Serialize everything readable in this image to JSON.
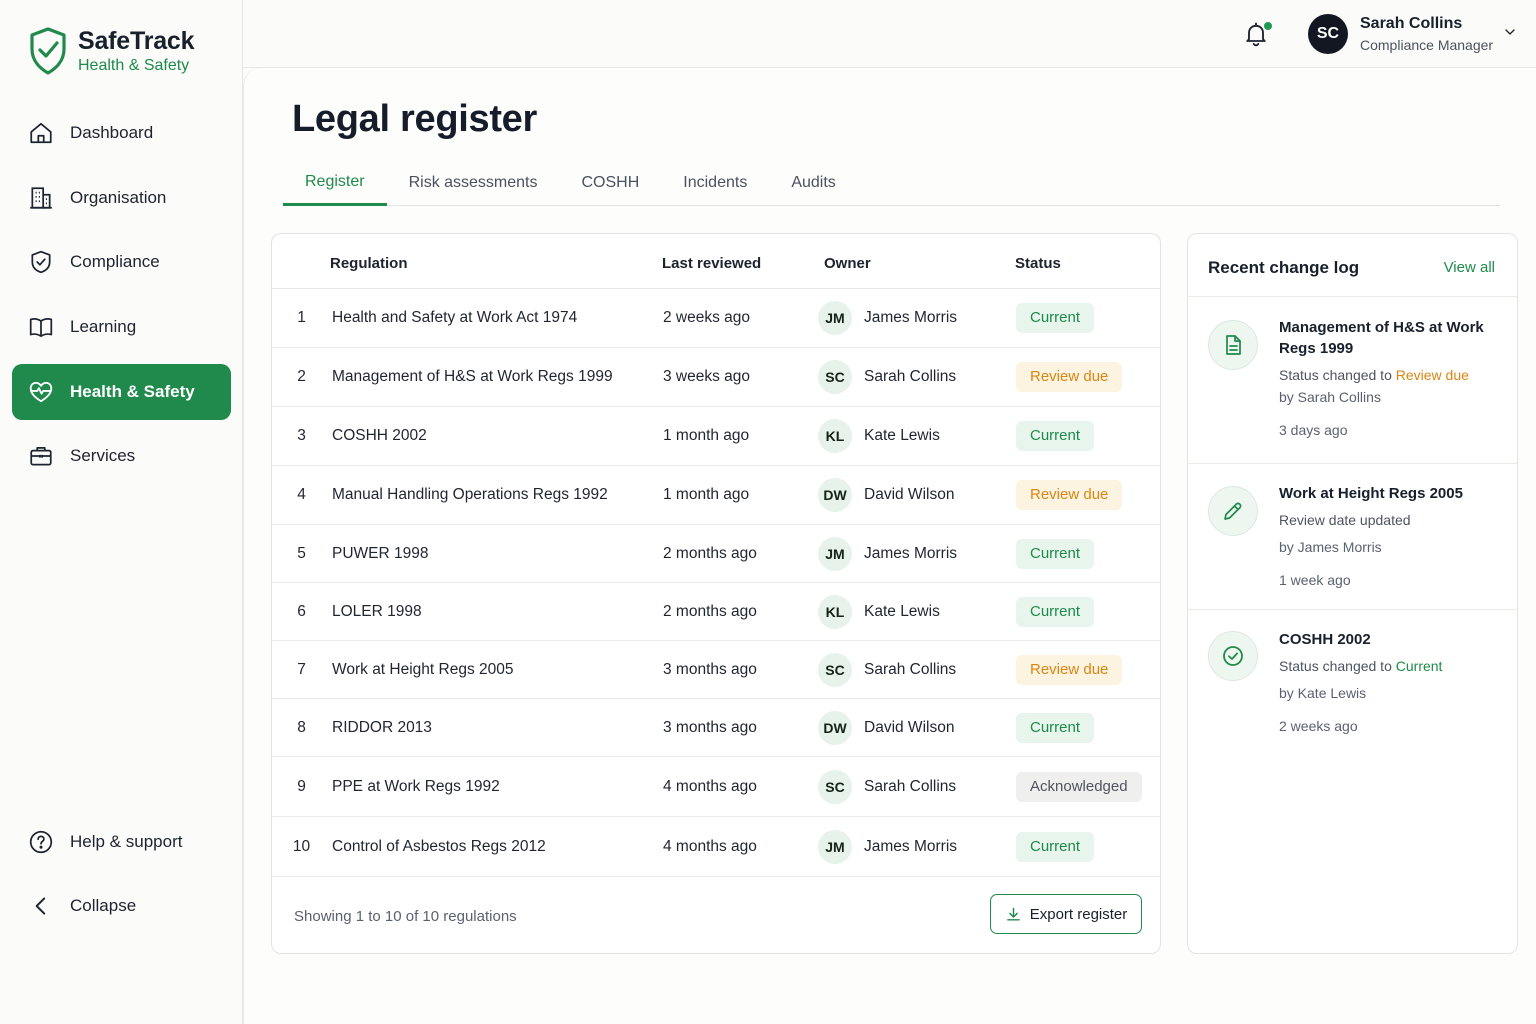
{
  "brand": {
    "name": "SafeTrack",
    "subtitle": "Health & Safety"
  },
  "nav": {
    "items": [
      {
        "label": "Dashboard",
        "icon": "home-icon"
      },
      {
        "label": "Organisation",
        "icon": "building-icon"
      },
      {
        "label": "Compliance",
        "icon": "shield-check-icon"
      },
      {
        "label": "Learning",
        "icon": "book-icon"
      },
      {
        "label": "Health & Safety",
        "icon": "heart-pulse-icon",
        "active": true
      },
      {
        "label": "Services",
        "icon": "briefcase-icon"
      }
    ],
    "bottom": [
      {
        "label": "Help & support",
        "icon": "help-icon"
      },
      {
        "label": "Collapse",
        "icon": "chevron-left-icon"
      }
    ]
  },
  "user": {
    "initials": "SC",
    "name": "Sarah Collins",
    "role": "Compliance Manager"
  },
  "page": {
    "title": "Legal register"
  },
  "tabs": [
    {
      "label": "Register",
      "active": true
    },
    {
      "label": "Risk assessments"
    },
    {
      "label": "COSHH"
    },
    {
      "label": "Incidents"
    },
    {
      "label": "Audits"
    }
  ],
  "table": {
    "headers": {
      "regulation": "Regulation",
      "last_reviewed": "Last reviewed",
      "owner": "Owner",
      "status": "Status"
    },
    "rows": [
      {
        "num": "1",
        "regulation": "Health and Safety at Work Act 1974",
        "reviewed": "2 weeks ago",
        "initials": "JM",
        "owner": "James Morris",
        "status": "Current",
        "kind": "current"
      },
      {
        "num": "2",
        "regulation": "Management of H&S at Work Regs 1999",
        "reviewed": "3 weeks ago",
        "initials": "SC",
        "owner": "Sarah Collins",
        "status": "Review due",
        "kind": "due"
      },
      {
        "num": "3",
        "regulation": "COSHH 2002",
        "reviewed": "1 month ago",
        "initials": "KL",
        "owner": "Kate Lewis",
        "status": "Current",
        "kind": "current"
      },
      {
        "num": "4",
        "regulation": "Manual Handling Operations Regs 1992",
        "reviewed": "1 month ago",
        "initials": "DW",
        "owner": "David Wilson",
        "status": "Review due",
        "kind": "due"
      },
      {
        "num": "5",
        "regulation": "PUWER 1998",
        "reviewed": "2 months ago",
        "initials": "JM",
        "owner": "James Morris",
        "status": "Current",
        "kind": "current"
      },
      {
        "num": "6",
        "regulation": "LOLER 1998",
        "reviewed": "2 months ago",
        "initials": "KL",
        "owner": "Kate Lewis",
        "status": "Current",
        "kind": "current"
      },
      {
        "num": "7",
        "regulation": "Work at Height Regs 2005",
        "reviewed": "3 months ago",
        "initials": "SC",
        "owner": "Sarah Collins",
        "status": "Review due",
        "kind": "due"
      },
      {
        "num": "8",
        "regulation": "RIDDOR 2013",
        "reviewed": "3 months ago",
        "initials": "DW",
        "owner": "David Wilson",
        "status": "Current",
        "kind": "current"
      },
      {
        "num": "9",
        "regulation": "PPE at Work Regs 1992",
        "reviewed": "4 months ago",
        "initials": "SC",
        "owner": "Sarah Collins",
        "status": "Acknowledged",
        "kind": "ack"
      },
      {
        "num": "10",
        "regulation": "Control of Asbestos Regs 2012",
        "reviewed": "4 months ago",
        "initials": "JM",
        "owner": "James Morris",
        "status": "Current",
        "kind": "current"
      }
    ],
    "footer": "Showing 1 to 10 of 10 regulations",
    "export_label": "Export register"
  },
  "changelog": {
    "title": "Recent change log",
    "view_all": "View all",
    "items": [
      {
        "icon": "document-icon",
        "title": "Management of H&S at Work Regs 1999",
        "desc_prefix": "Status changed to ",
        "desc_highlight": "Review due",
        "by": "by Sarah Collins",
        "time": "3 days ago"
      },
      {
        "icon": "pencil-icon",
        "title": "Work at Height Regs 2005",
        "desc_prefix": "Review date updated",
        "desc_highlight": "",
        "by": "by James Morris",
        "time": "1 week ago"
      },
      {
        "icon": "check-circle-icon",
        "title": "COSHH 2002",
        "desc_prefix": "Status changed to ",
        "desc_highlight": "Current",
        "by": "by Kate Lewis",
        "time": "2 weeks ago"
      }
    ]
  },
  "colors": {
    "accent": "#1f8a4c",
    "warning": "#d98612",
    "dark": "#121722"
  }
}
